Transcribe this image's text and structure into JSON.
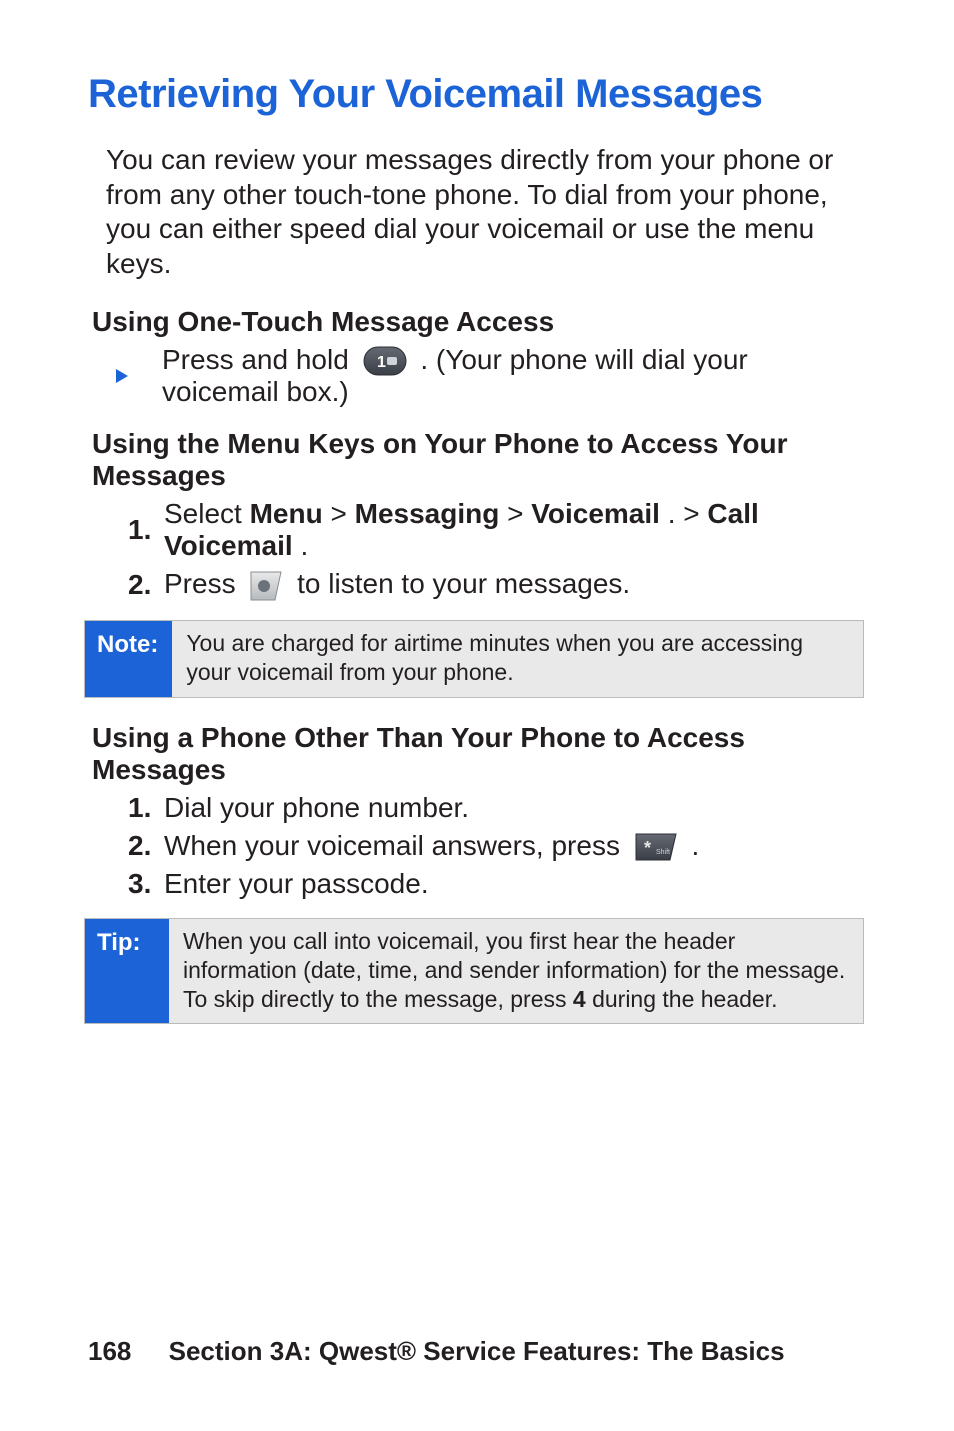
{
  "title": "Retrieving Your Voicemail Messages",
  "intro": "You can review your messages directly from your phone or from any other touch-tone phone. To dial from your phone, you can either speed dial your voicemail or use the menu keys.",
  "section_a": {
    "heading": "Using One-Touch Message Access",
    "bullet_pre": "Press and hold ",
    "bullet_post": ". (Your phone will dial your voicemail box.)"
  },
  "section_b": {
    "heading": "Using the Menu Keys on Your Phone to Access Your Messages",
    "step1_pre": "Select ",
    "step1_menu": "Menu",
    "step1_sep": " > ",
    "step1_msg": "Messaging",
    "step1_vm": "Voicemail",
    "step1_dot": ". > ",
    "step1_call": "Call Voicemail",
    "step1_end": ".",
    "step2_pre": "Press ",
    "step2_post": " to listen to your messages."
  },
  "note": {
    "label": "Note:",
    "text": "You are charged for airtime minutes when you are accessing your voicemail from your phone."
  },
  "section_c": {
    "heading": "Using a Phone Other Than Your Phone to Access Messages",
    "step1": "Dial your phone number.",
    "step2_pre": "When your voicemail answers, press ",
    "step2_post": ".",
    "step3": "Enter your passcode."
  },
  "tip": {
    "label": "Tip:",
    "text_pre": "When you call into voicemail, you first hear the header information (date, time, and sender information) for the message. To skip directly to the message, press ",
    "key": "4",
    "text_post": " during the header."
  },
  "footer": {
    "page": "168",
    "section": "Section 3A: Qwest® Service Features: The Basics"
  },
  "nums": {
    "one": "1.",
    "two": "2.",
    "three": "3."
  }
}
